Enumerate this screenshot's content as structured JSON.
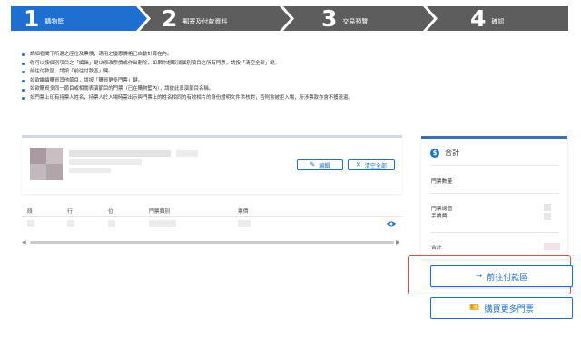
{
  "stepper": {
    "steps": [
      {
        "number": "1",
        "label": "購物籃"
      },
      {
        "number": "2",
        "label": "郵寄及付款資料"
      },
      {
        "number": "3",
        "label": "交易預覽"
      },
      {
        "number": "4",
        "label": "確認"
      }
    ],
    "active_color": "#1e6fd0",
    "inactive_color": "#5d5d5d"
  },
  "notes": [
    "請細看閣下所選之座位及票價，適用之優惠價格已自動計算在內。",
    "你可以按個別項目之「編輯」鍵以修改票價或作出刪除，如果你想取消個別項目之所有門票，請按「清空全部」鍵。",
    "前往付款區，請按「前往付款區」鍵。",
    "如欲繼續購買其他節目，請按「購買更多門票」鍵。",
    "如欲購買多同一節目或相關表演節目的門票（已在購物籃內），請彼此表演節目名稱。",
    "如門票上印有持票人姓名，持票人於入場時需出示與門票上的姓名相同的有效相片的身份證明文件供核對，否則會被拒入場，所涉票款亦會不獲退還。"
  ],
  "cart": {
    "edit_label": "編輯",
    "edit_icon": "edit-icon",
    "clear_label": "清空全部",
    "clear_icon": "close-icon",
    "columns": [
      "段",
      "行",
      "位",
      "門票類別",
      "票價"
    ]
  },
  "summary": {
    "title": "合計",
    "ticket_count_label": "門票數量",
    "ticket_total_label": "門票總值",
    "fee_label": "手續費",
    "total_label": "合計"
  },
  "actions": {
    "pay_label": "前往付款區",
    "pay_icon": "arrow-right-icon",
    "more_label": "購買更多門票",
    "more_icon": "ticket-icon",
    "highlight_color": "#e24b4b"
  }
}
